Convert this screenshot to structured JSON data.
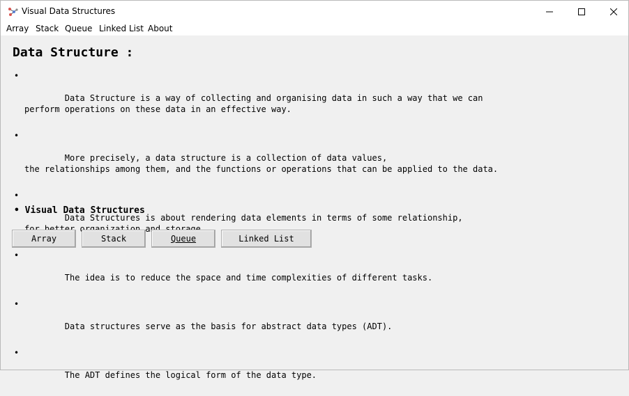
{
  "window": {
    "title": "Visual Data Structures",
    "icon": "molecule-app-icon"
  },
  "menubar": {
    "items": [
      "Array",
      "Stack",
      "Queue",
      "Linked List",
      "About"
    ]
  },
  "content": {
    "heading": "Data Structure :",
    "bullets": [
      "Data Structure is a way of collecting and organising data in such a way that we can\nperform operations on these data in an effective way.",
      "More precisely, a data structure is a collection of data values,\nthe relationships among them, and the functions or operations that can be applied to the data.",
      "Data Structures is about rendering data elements in terms of some relationship,\nfor better organization and storage.",
      "The idea is to reduce the space and time complexities of different tasks.",
      "Data structures serve as the basis for abstract data types (ADT).",
      "The ADT defines the logical form of the data type."
    ],
    "bullet_symbol": "•",
    "sub_heading": "• Visual Data Structures",
    "buttons": [
      "Array",
      "Stack",
      "Queue",
      "Linked List"
    ]
  },
  "colors": {
    "background": "#f0f0f0",
    "titlebar": "#ffffff",
    "button": "#e1e1e1"
  }
}
